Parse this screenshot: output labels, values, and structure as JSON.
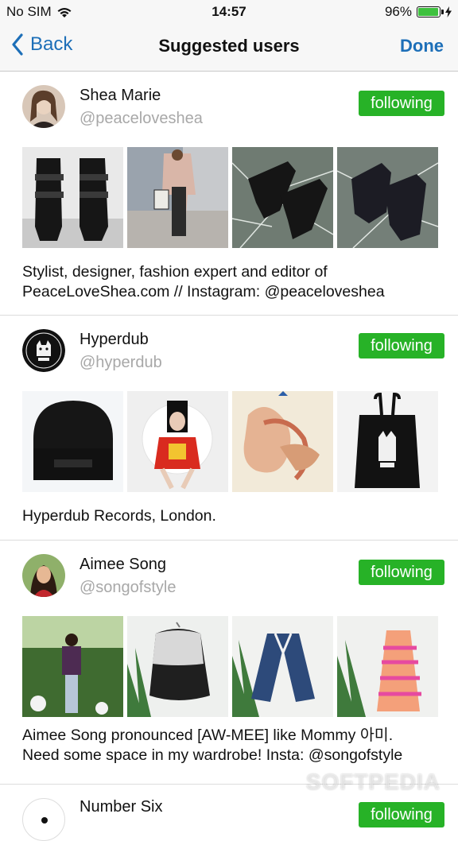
{
  "status_bar": {
    "carrier": "No SIM",
    "time": "14:57",
    "battery": "96%",
    "battery_level": 0.96,
    "wifi_icon": "wifi-icon"
  },
  "nav": {
    "back_label": "Back",
    "title": "Suggested users",
    "done_label": "Done"
  },
  "users": [
    {
      "name": "Shea Marie",
      "handle": "@peaceloveshea",
      "follow_label": "following",
      "bio_line1": "Stylist, designer, fashion expert and editor of",
      "bio_line2": "PeaceLoveShea.com // Instagram: @peaceloveshea"
    },
    {
      "name": "Hyperdub",
      "handle": "@hyperdub",
      "follow_label": "following",
      "bio_line1": "Hyperdub Records, London.",
      "bio_line2": ""
    },
    {
      "name": "Aimee Song",
      "handle": "@songofstyle",
      "follow_label": "following",
      "bio_line1": "Aimee Song pronounced [AW-MEE] like Mommy 아미.",
      "bio_line2": "Need some space in my wardrobe! Insta: @songofstyle"
    },
    {
      "name": "Number Six",
      "handle": "",
      "follow_label": "following",
      "bio_line1": "",
      "bio_line2": ""
    }
  ],
  "watermark": "SOFTPEDIA",
  "colors": {
    "accent": "#1d6fb8",
    "follow_green": "#27b227",
    "handle_gray": "#a8a8a8"
  }
}
